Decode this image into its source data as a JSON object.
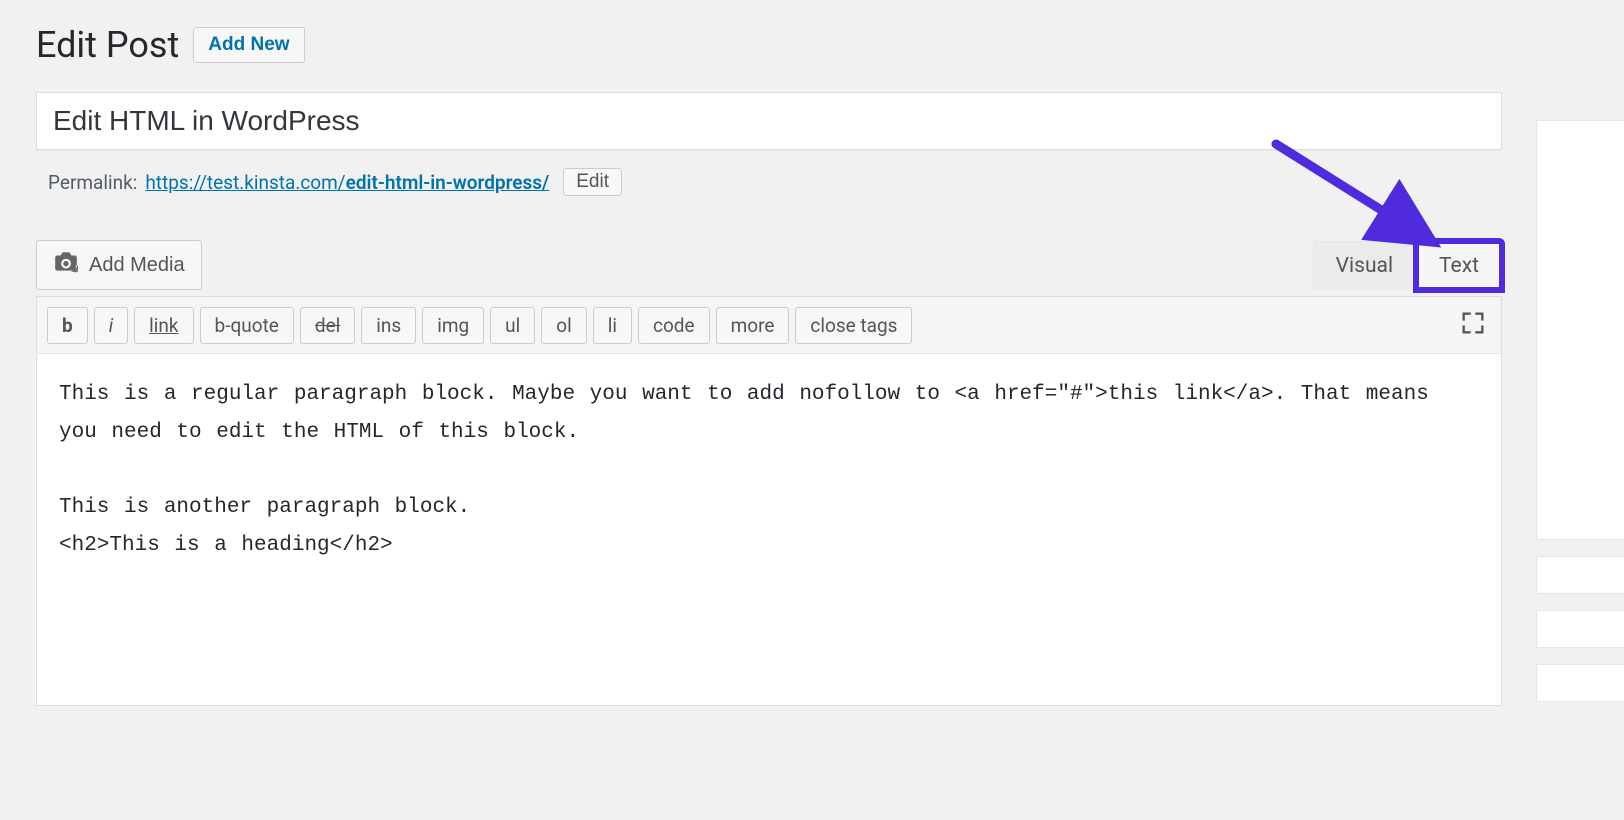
{
  "header": {
    "page_title": "Edit Post",
    "add_new": "Add New"
  },
  "post": {
    "title": "Edit HTML in WordPress",
    "permalink_label": "Permalink:",
    "permalink_base": "https://test.kinsta.com/",
    "permalink_slug": "edit-html-in-wordpress/",
    "edit_btn": "Edit"
  },
  "editor": {
    "add_media": "Add Media",
    "tabs": {
      "visual": "Visual",
      "text": "Text"
    },
    "active_tab": "text",
    "quicktags": {
      "b": "b",
      "i": "i",
      "link": "link",
      "bquote": "b-quote",
      "del": "del",
      "ins": "ins",
      "img": "img",
      "ul": "ul",
      "ol": "ol",
      "li": "li",
      "code": "code",
      "more": "more",
      "close": "close tags"
    },
    "content": "This is a regular paragraph block. Maybe you want to add nofollow to <a href=\"#\">this link</a>. That means you need to edit the HTML of this block.\n\nThis is another paragraph block.\n<h2>This is a heading</h2>"
  },
  "annotation": {
    "target": "text-tab",
    "color": "#4f2bdd"
  }
}
